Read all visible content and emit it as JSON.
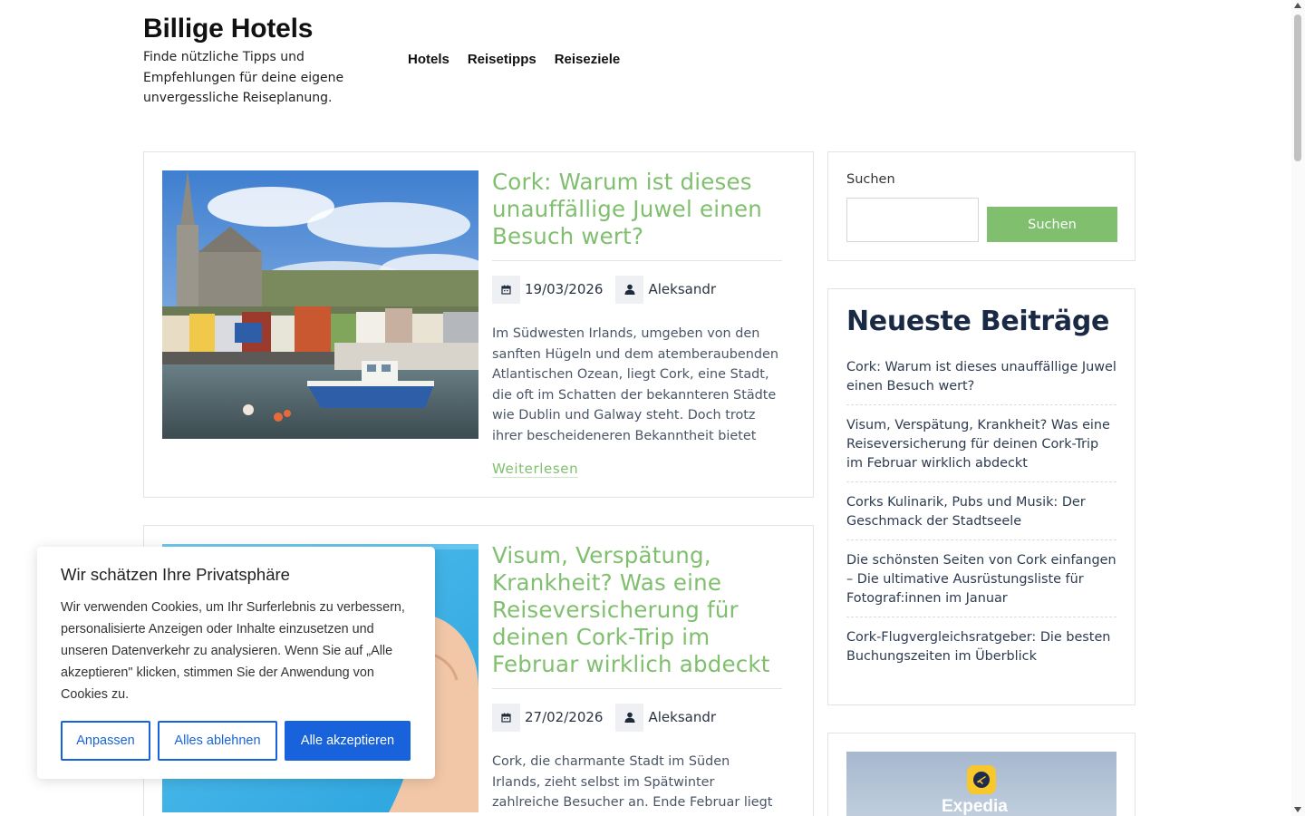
{
  "header": {
    "site_title": "Billige Hotels",
    "tagline": "Finde nützliche Tipps und Empfehlungen für deine eigene unvergessliche Reiseplanung.",
    "nav": [
      "Hotels",
      "Reisetipps",
      "Reiseziele"
    ]
  },
  "posts": [
    {
      "title": "Cork: Warum ist dieses unauffällige Juwel einen Besuch wert?",
      "date": "19/03/2026",
      "author": "Aleksandr",
      "excerpt": "Im Südwesten Irlands, umgeben von den sanften Hügeln und dem atemberaubenden Atlantischen Ozean, liegt Cork, eine Stadt, die oft im Schatten der bekannteren Städte wie Dublin und Galway steht. Doch trotz ihrer bescheideneren Bekanntheit bietet",
      "read_more": "Weiterlesen"
    },
    {
      "title": "Visum, Verspätung, Krankheit? Was eine Reiseversicherung für deinen Cork-Trip im Februar wirklich abdeckt",
      "date": "27/02/2026",
      "author": "Aleksandr",
      "excerpt": "Cork, die charmante Stadt im Süden Irlands, zieht selbst im Spätwinter zahlreiche Besucher an. Ende Februar liegt noch ein Hauch von"
    }
  ],
  "sidebar": {
    "search": {
      "label": "Suchen",
      "button": "Suchen",
      "placeholder": ""
    },
    "recent": {
      "heading": "Neueste Beiträge",
      "items": [
        "Cork: Warum ist dieses unauffällige Juwel einen Besuch wert?",
        "Visum, Verspätung, Krankheit? Was eine Reiseversicherung für deinen Cork-Trip im Februar wirklich abdeckt",
        "Corks Kulinarik, Pubs und Musik: Der Geschmack der Stadtseele",
        "Die schönsten Seiten von Cork einfangen – Die ultimative Ausrüstungsliste für Fotograf:innen im Januar",
        "Cork-Flugvergleichsratgeber: Die besten Buchungszeiten im Überblick"
      ]
    },
    "ad": {
      "brand": "Expedia"
    }
  },
  "cookie": {
    "title": "Wir schätzen Ihre Privatsphäre",
    "text": "Wir verwenden Cookies, um Ihr Surferlebnis zu verbessern, personalisierte Anzeigen oder Inhalte einzusetzen und unseren Datenverkehr zu analysieren. Wenn Sie auf „Alle akzeptieren\" klicken, stimmen Sie der Anwendung von Cookies zu.",
    "btn_customize": "Anpassen",
    "btn_reject": "Alles ablehnen",
    "btn_accept": "Alle akzeptieren"
  },
  "colors": {
    "accent_green": "#7fbf6e",
    "cookie_blue": "#1863dc",
    "heading_navy": "#1b2a44"
  },
  "icons": {
    "date": "calendar-icon",
    "author": "user-icon"
  }
}
